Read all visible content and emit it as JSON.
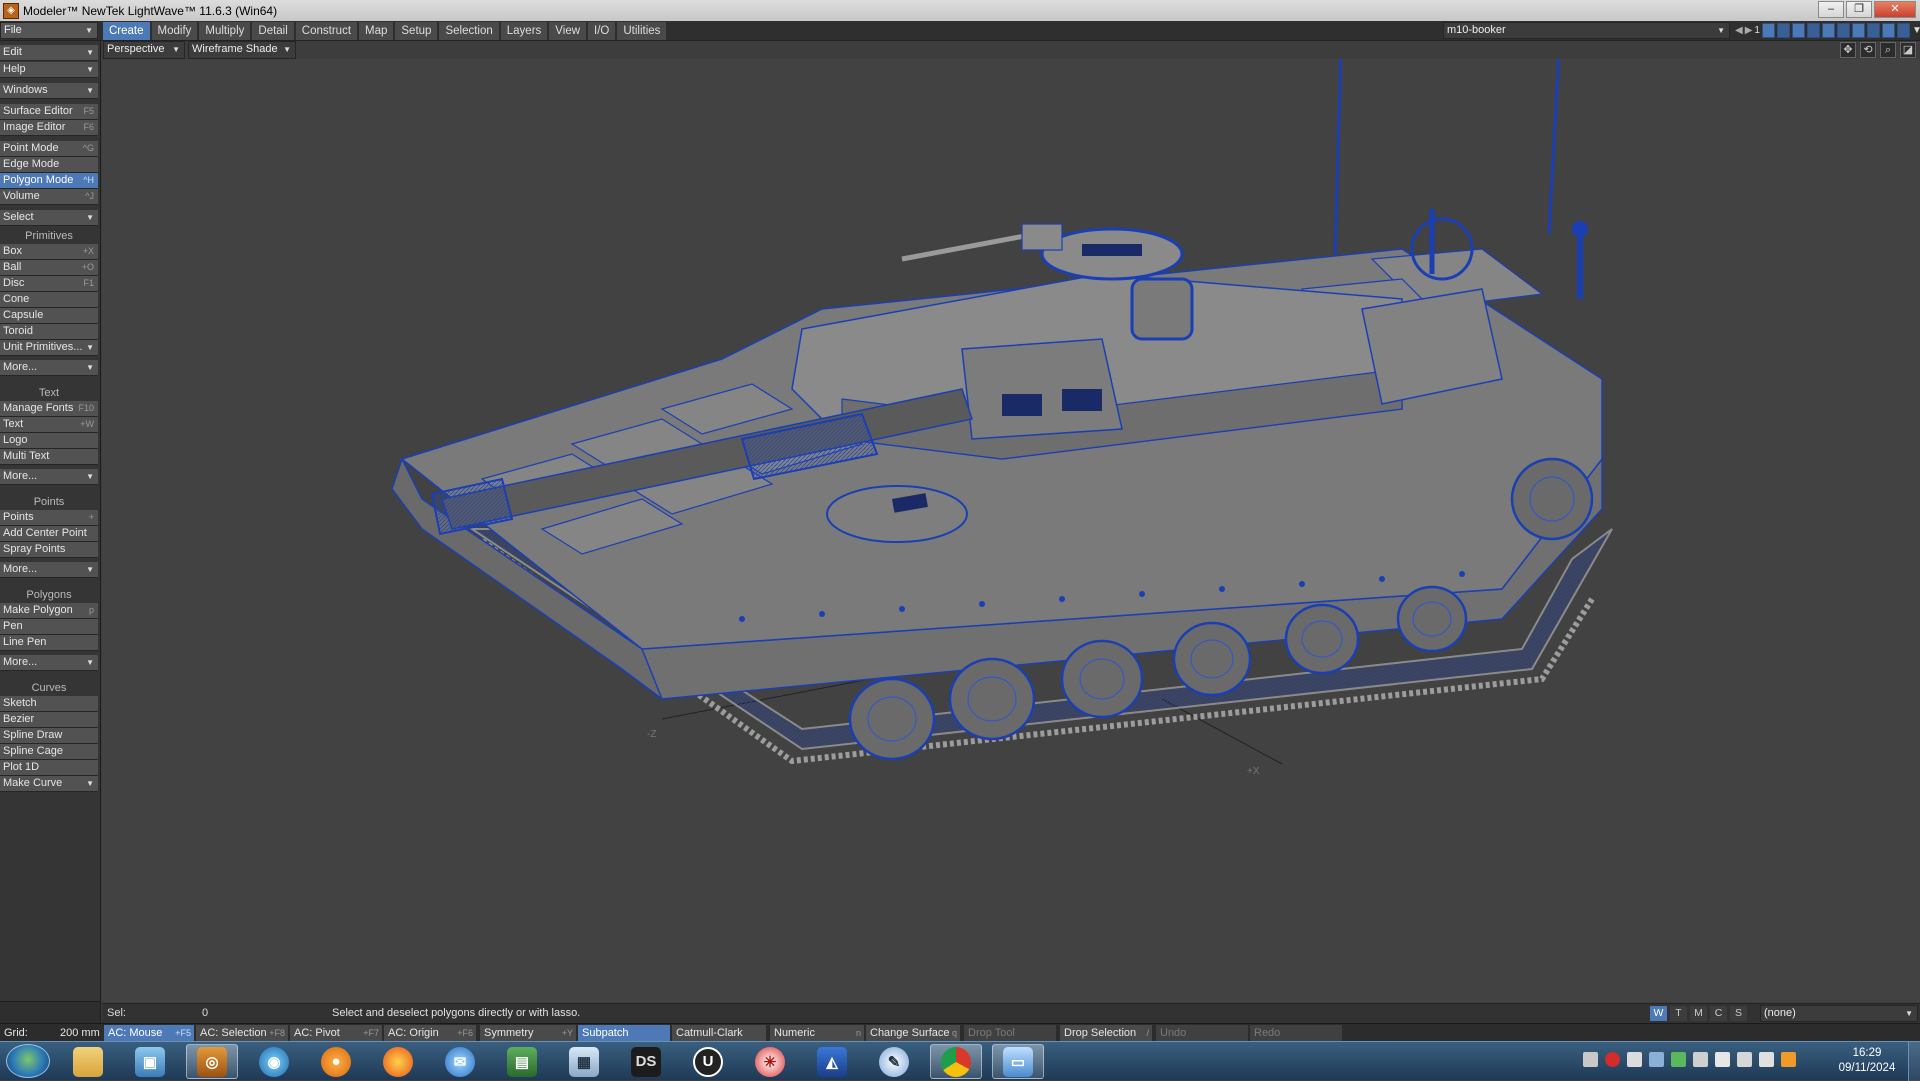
{
  "window": {
    "title": "Modeler™ NewTek LightWave™ 11.6.3 (Win64)",
    "controls": [
      "–",
      "❐",
      "✕"
    ]
  },
  "menubar": {
    "file_label": "File",
    "tabs": [
      "Create",
      "Modify",
      "Multiply",
      "Detail",
      "Construct",
      "Map",
      "Setup",
      "Selection",
      "Layers",
      "View",
      "I/O",
      "Utilities"
    ],
    "active_tab": "Create",
    "layer_name": "m10-booker",
    "layer_number": "1"
  },
  "viewport_bar": {
    "projection": "Perspective",
    "shading": "Wireframe Shade"
  },
  "sidebar": {
    "edit": "Edit",
    "help": "Help",
    "windows": "Windows",
    "surface_editor": {
      "label": "Surface Editor",
      "shortcut": "F5"
    },
    "image_editor": {
      "label": "Image Editor",
      "shortcut": "F6"
    },
    "point_mode": {
      "label": "Point Mode",
      "shortcut": "^G"
    },
    "edge_mode": {
      "label": "Edge Mode",
      "shortcut": ""
    },
    "polygon_mode": {
      "label": "Polygon Mode",
      "shortcut": "^H"
    },
    "volume": {
      "label": "Volume",
      "shortcut": "^J"
    },
    "select": "Select",
    "primitives_header": "Primitives",
    "box": {
      "label": "Box",
      "shortcut": "+X"
    },
    "ball": {
      "label": "Ball",
      "shortcut": "+O"
    },
    "disc": {
      "label": "Disc",
      "shortcut": "F1"
    },
    "cone": "Cone",
    "capsule": "Capsule",
    "toroid": "Toroid",
    "unit_primitives": "Unit Primitives...",
    "more": "More...",
    "text_header": "Text",
    "manage_fonts": {
      "label": "Manage Fonts",
      "shortcut": "F10"
    },
    "text_tool": {
      "label": "Text",
      "shortcut": "+W"
    },
    "logo": "Logo",
    "multi_text": "Multi Text",
    "points_header": "Points",
    "points_tool": {
      "label": "Points",
      "shortcut": "+"
    },
    "add_center_point": "Add Center Point",
    "spray_points": "Spray Points",
    "polygons_header": "Polygons",
    "make_polygon": {
      "label": "Make Polygon",
      "shortcut": "p"
    },
    "pen": "Pen",
    "line_pen": "Line Pen",
    "curves_header": "Curves",
    "sketch": "Sketch",
    "bezier": "Bezier",
    "spline_draw": "Spline Draw",
    "spline_cage": "Spline Cage",
    "plot_1d": "Plot 1D",
    "make_curve": "Make Curve"
  },
  "status": {
    "sel_label": "Sel:",
    "sel_count": "0",
    "help_text": "Select and deselect polygons directly or with lasso.",
    "vmap_tabs": [
      "W",
      "T",
      "M",
      "C",
      "S"
    ],
    "vmap_value": "(none)"
  },
  "toolrow": {
    "grid_label": "Grid:",
    "grid_value": "200 mm",
    "ac_mouse": {
      "label": "AC: Mouse",
      "shortcut": "+F5"
    },
    "ac_selection": {
      "label": "AC: Selection",
      "shortcut": "+F8"
    },
    "ac_pivot": {
      "label": "AC: Pivot",
      "shortcut": "+F7"
    },
    "ac_origin": {
      "label": "AC: Origin",
      "shortcut": "+F6"
    },
    "symmetry": {
      "label": "Symmetry",
      "shortcut": "+Y"
    },
    "subpatch": "Subpatch",
    "catmull": "Catmull-Clark",
    "numeric": {
      "label": "Numeric",
      "shortcut": "n"
    },
    "change_surface": {
      "label": "Change Surface",
      "shortcut": "q"
    },
    "drop_tool": "Drop Tool",
    "drop_selection": {
      "label": "Drop Selection",
      "shortcut": "/"
    },
    "undo": "Undo",
    "redo": "Redo"
  },
  "viewport": {
    "axis_z": "-Z",
    "axis_x": "+X"
  },
  "taskbar": {
    "apps": [
      "file-explorer",
      "photo-viewer",
      "lightwave-modeler",
      "lightwave-hub",
      "blender",
      "firefox",
      "thunderbird",
      "monitor",
      "calculator",
      "daz-studio",
      "unity",
      "inkscape",
      "affinity",
      "vegas",
      "chrome",
      "windows-explorer"
    ],
    "daz_label": "DS",
    "unity_label": "U",
    "time": "16:29",
    "date": "09/11/2024"
  },
  "colors": {
    "accent": "#4d79b6",
    "wire": "#1a3fb4",
    "background": "#424242",
    "taskbar": "#2a4a6a"
  }
}
